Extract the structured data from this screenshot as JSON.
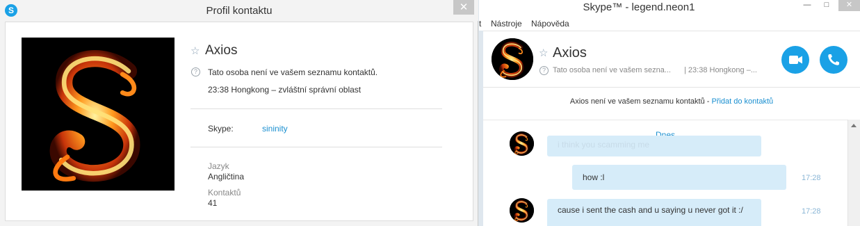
{
  "profile_window": {
    "title": "Profil kontaktu",
    "close_glyph": "✕",
    "app_icon": "skype-icon",
    "contact": {
      "name": "Axios",
      "status_text": "Tato osoba není ve vašem seznamu kontaktů.",
      "local_time": "23:38 Hongkong – zvláštní správní oblast",
      "skype_label": "Skype:",
      "skype_name": "sininity",
      "language_label": "Jazyk",
      "language_value": "Angličtina",
      "contacts_label": "Kontaktů",
      "contacts_value": "41"
    }
  },
  "skype_window": {
    "title": "Skype™ - legend.neon1",
    "menu": [
      "t",
      "Nástroje",
      "Nápověda"
    ],
    "controls": {
      "minimize": "—",
      "maximize": "□",
      "close": "✕"
    },
    "header": {
      "name": "Axios",
      "status_text": "Tato osoba není ve vašem sezna...",
      "local_time": "| 23:38 Hongkong –...",
      "video_call_icon": "video-camera-icon",
      "audio_call_icon": "phone-icon"
    },
    "notice": {
      "text": "Axios není ve vašem seznamu kontaktů - ",
      "link": "Přidat do kontaktů"
    },
    "day_separator": "Dnes",
    "messages": [
      {
        "from": "contact",
        "text": "i think you scamming me",
        "time": ""
      },
      {
        "from": "me",
        "text": "how :l",
        "time": "17:28"
      },
      {
        "from": "contact",
        "text": "cause i sent the cash and u saying u never got it :/",
        "time": "17:28"
      }
    ]
  },
  "colors": {
    "accent": "#1aa1e6",
    "bubble": "#d6ecf9",
    "link": "#1a8fd0",
    "time": "#8ab6d6"
  }
}
